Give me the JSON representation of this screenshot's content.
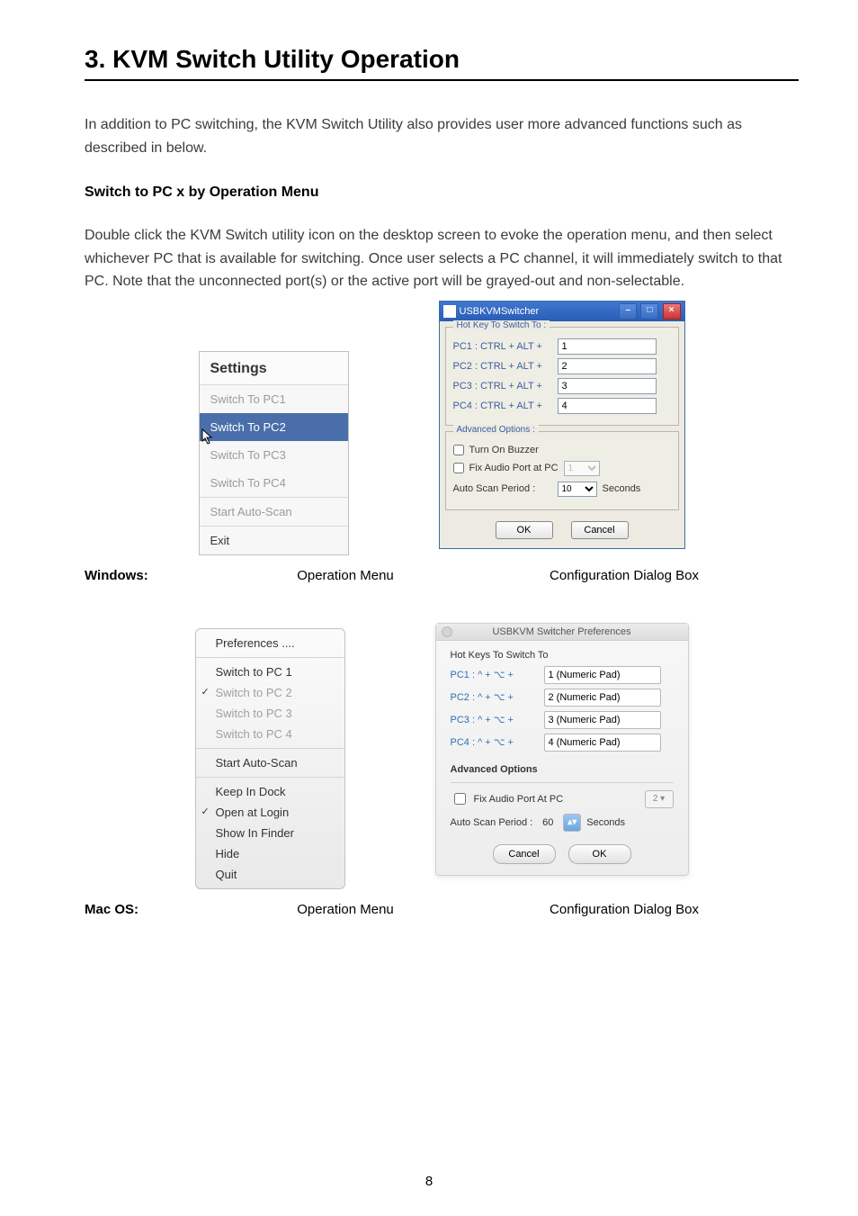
{
  "heading": "3.  KVM Switch Utility Operation",
  "intro_para": "In addition to PC switching, the KVM Switch Utility also provides user more advanced functions such as described in below.",
  "sub_heading": "Switch to PC x by Operation Menu",
  "desc_para": "Double click the KVM Switch utility icon on the desktop screen to evoke the operation menu, and then select whichever PC that is available for switching. Once user selects a PC channel, it will immediately switch to that PC. Note that the unconnected port(s) or the active port will be grayed-out and non-selectable.",
  "windows_label": "Windows:",
  "macos_label": "Mac OS:",
  "caption_op": "Operation Menu",
  "caption_cfg": "Configuration Dialog Box",
  "win_menu": {
    "title": "Settings",
    "items": [
      "Switch To PC1",
      "Switch To PC2",
      "Switch To PC3",
      "Switch To PC4"
    ],
    "selected_index": 1,
    "scan": "Start Auto-Scan",
    "exit": "Exit"
  },
  "win_dialog": {
    "title": "USBKVMSwitcher",
    "group1_title": "Hot Key To Switch To :",
    "hotkeys": [
      {
        "label": "PC1 : CTRL + ALT +",
        "value": "1"
      },
      {
        "label": "PC2 : CTRL + ALT +",
        "value": "2"
      },
      {
        "label": "PC3 : CTRL + ALT +",
        "value": "3"
      },
      {
        "label": "PC4 : CTRL + ALT +",
        "value": "4"
      }
    ],
    "group2_title": "Advanced Options :",
    "buzzer_label": "Turn On Buzzer",
    "fix_audio_label": "Fix Audio Port at PC",
    "fix_audio_value": "1",
    "scan_label": "Auto Scan Period :",
    "scan_value": "10",
    "scan_unit": "Seconds",
    "ok": "OK",
    "cancel": "Cancel"
  },
  "mac_menu": {
    "pref": "Preferences ....",
    "items": [
      "Switch to PC 1",
      "Switch to PC 2",
      "Switch to PC 3",
      "Switch to PC 4"
    ],
    "checked_index": 1,
    "gray_indices": [
      1,
      2,
      3
    ],
    "scan": "Start Auto-Scan",
    "keep_dock": "Keep In Dock",
    "open_login": "Open at Login",
    "show_finder": "Show In Finder",
    "hide": "Hide",
    "quit": "Quit"
  },
  "mac_dialog": {
    "title": "USBKVM Switcher Preferences",
    "hk_title": "Hot Keys To Switch To",
    "hotkeys": [
      {
        "label": "PC1 : ^ + ⌥ +",
        "value": "1 (Numeric Pad)"
      },
      {
        "label": "PC2 : ^ + ⌥ +",
        "value": "2 (Numeric Pad)"
      },
      {
        "label": "PC3 : ^ + ⌥ +",
        "value": "3 (Numeric Pad)"
      },
      {
        "label": "PC4 : ^ + ⌥ +",
        "value": "4 (Numeric Pad)"
      }
    ],
    "adv_title": "Advanced Options",
    "fix_audio_label": "Fix Audio Port At PC",
    "fix_audio_value": "2",
    "scan_label": "Auto Scan Period :",
    "scan_value": "60",
    "scan_unit": "Seconds",
    "cancel": "Cancel",
    "ok": "OK"
  },
  "page_number": "8"
}
